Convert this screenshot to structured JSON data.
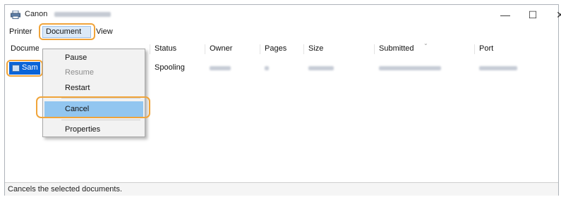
{
  "window": {
    "title": "Canon",
    "controls": {
      "minimize": "—",
      "maximize": "☐",
      "close": "✕"
    }
  },
  "menubar": {
    "items": [
      {
        "label": "Printer"
      },
      {
        "label": "Document"
      },
      {
        "label": "View"
      }
    ]
  },
  "document_menu": {
    "items": [
      {
        "label": "Pause",
        "enabled": true
      },
      {
        "label": "Resume",
        "enabled": false
      },
      {
        "label": "Restart",
        "enabled": true
      },
      {
        "label": "Cancel",
        "enabled": true,
        "highlighted": true
      },
      {
        "label": "Properties",
        "enabled": true
      }
    ]
  },
  "columns": [
    {
      "label": "Document Name"
    },
    {
      "label": "Status"
    },
    {
      "label": "Owner"
    },
    {
      "label": "Pages"
    },
    {
      "label": "Size"
    },
    {
      "label": "Submitted"
    },
    {
      "label": "Port"
    }
  ],
  "rows": [
    {
      "document_name": "Sam",
      "status": "Spooling",
      "selected": true
    }
  ],
  "statusbar": {
    "text": "Cancels the selected documents."
  },
  "colors": {
    "highlight": "#f0a43a",
    "selection": "#0a64d8",
    "menu_hover": "#92c6f0"
  }
}
